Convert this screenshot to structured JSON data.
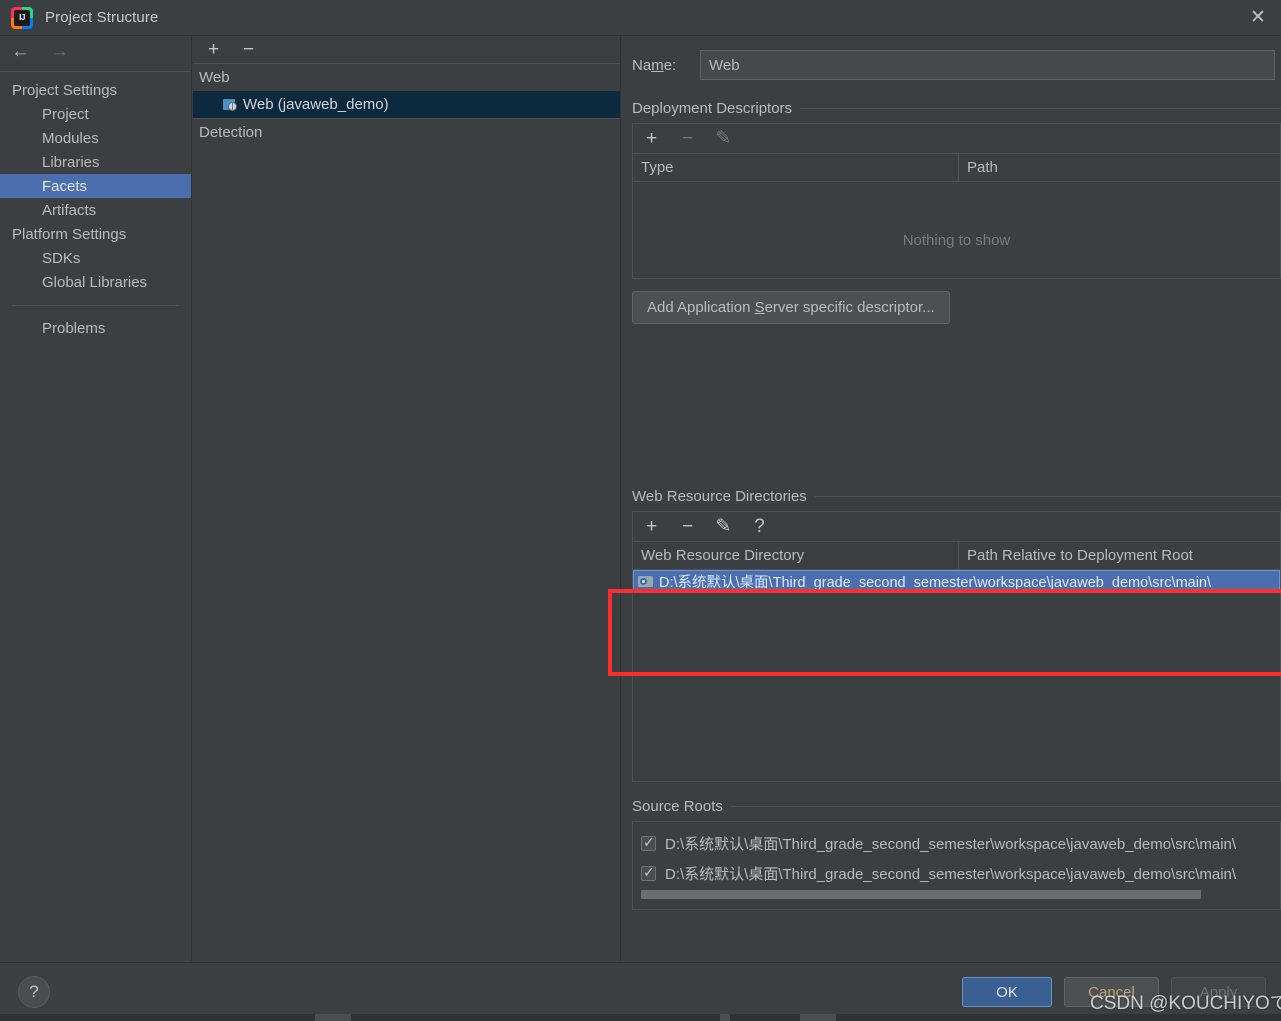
{
  "window": {
    "title": "Project Structure",
    "logo_icon": "intellij-idea-logo",
    "close_icon": "✕"
  },
  "nav": {
    "back_icon": "←",
    "forward_icon": "→"
  },
  "sidebar": {
    "groups": [
      {
        "label": "Project Settings",
        "items": [
          {
            "label": "Project",
            "selected": false
          },
          {
            "label": "Modules",
            "selected": false
          },
          {
            "label": "Libraries",
            "selected": false
          },
          {
            "label": "Facets",
            "selected": true
          },
          {
            "label": "Artifacts",
            "selected": false
          }
        ]
      },
      {
        "label": "Platform Settings",
        "items": [
          {
            "label": "SDKs",
            "selected": false
          },
          {
            "label": "Global Libraries",
            "selected": false
          }
        ]
      }
    ],
    "problems": "Problems"
  },
  "tree": {
    "toolbar": {
      "add_icon": "+",
      "remove_icon": "−"
    },
    "group_web": "Web",
    "facet_item": "Web (javaweb_demo)",
    "facet_icon": "web-facet-icon",
    "group_detection": "Detection"
  },
  "facet": {
    "name_label_prefix": "Na",
    "name_label_mnemonic": "m",
    "name_label_suffix": "e:",
    "name_value": "Web",
    "deployment": {
      "section_title": "Deployment Descriptors",
      "toolbar": {
        "add_icon": "+",
        "remove_icon": "−",
        "edit_icon": "✎"
      },
      "columns": [
        "Type",
        "Path"
      ],
      "empty_text": "Nothing to show",
      "add_button": {
        "prefix": "Add Application ",
        "mnemonic": "S",
        "suffix": "erver specific descriptor..."
      }
    },
    "web_resources": {
      "section_title": "Web Resource Directories",
      "toolbar": {
        "add_icon": "+",
        "remove_icon": "−",
        "edit_icon": "✎",
        "help_icon": "?"
      },
      "columns": [
        "Web Resource Directory",
        "Path Relative to Deployment Root"
      ],
      "rows": [
        {
          "directory": "D:\\系统默认\\桌面\\Third_grade_second_semester\\workspace\\javaweb_demo\\src\\main\\",
          "icon": "directory-icon",
          "selected": true
        }
      ]
    },
    "source_roots": {
      "section_title": "Source Roots",
      "rows": [
        {
          "checked": true,
          "path": "D:\\系统默认\\桌面\\Third_grade_second_semester\\workspace\\javaweb_demo\\src\\main\\"
        },
        {
          "checked": true,
          "path": "D:\\系统默认\\桌面\\Third_grade_second_semester\\workspace\\javaweb_demo\\src\\main\\"
        }
      ]
    }
  },
  "footer": {
    "help_icon": "?",
    "ok": "OK",
    "cancel": "Cancel",
    "apply": "Apply"
  },
  "watermark": "CSDN @KOUCHIYOです",
  "colors": {
    "background": "#3c3f41",
    "selection_blue": "#4b6eaf",
    "tree_selection": "#0d293e",
    "annotation_red": "#ff2d2d",
    "ok_button": "#3a5f92"
  }
}
